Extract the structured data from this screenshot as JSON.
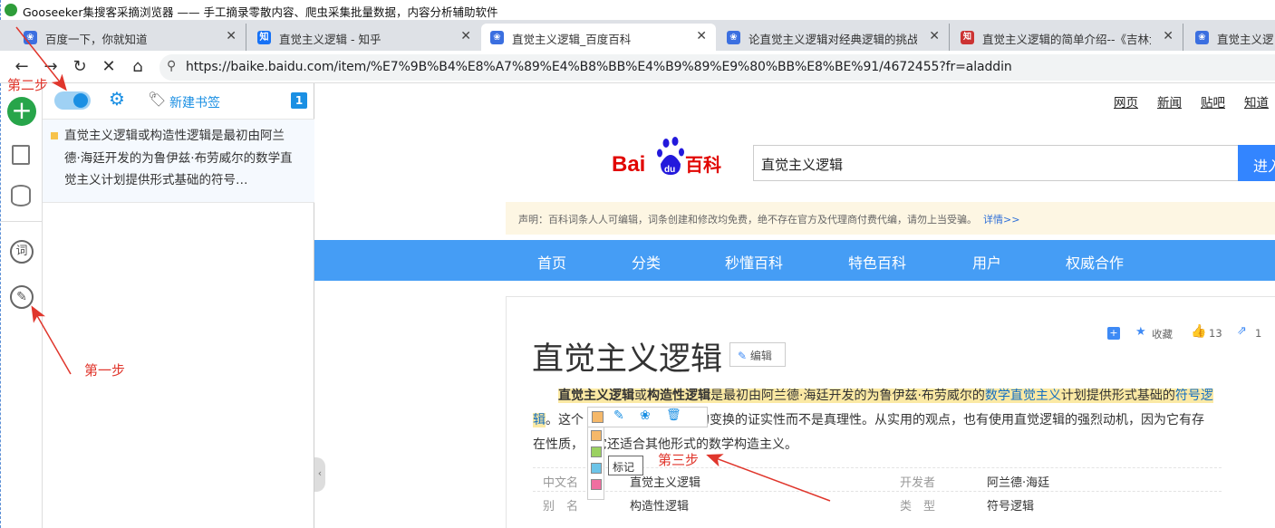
{
  "window": {
    "title": "Gooseeker集搜客采摘浏览器 —— 手工摘录零散内容、爬虫采集批量数据，内容分析辅助软件"
  },
  "tabs": [
    {
      "label": "百度一下，你就知道",
      "active": false,
      "favicon": "baidu-icon"
    },
    {
      "label": "直觉主义逻辑 - 知乎",
      "active": false,
      "favicon": "zhihu-icon"
    },
    {
      "label": "直觉主义逻辑_百度百科",
      "active": true,
      "favicon": "baidu-icon"
    },
    {
      "label": "论直觉主义逻辑对经典逻辑的挑战%C",
      "active": false,
      "favicon": "baidu-icon"
    },
    {
      "label": "直觉主义逻辑的简单介绍--《吉林大学",
      "active": false,
      "favicon": "cnki-icon"
    },
    {
      "label": "直觉主义逻",
      "active": false,
      "favicon": "baidu-icon"
    }
  ],
  "address_bar": {
    "url": "https://baike.baidu.com/item/%E7%9B%B4%E8%A7%89%E4%B8%BB%E4%B9%89%E9%80%BB%E8%BE%91/4672455?fr=aladdin"
  },
  "side_panel": {
    "new_bookmark": "新建书签",
    "count": "1",
    "note_text": "直觉主义逻辑或构造性逻辑是最初由阿兰德·海廷开发的为鲁伊兹·布劳威尔的数学直觉主义计划提供形式基础的符号…"
  },
  "annotations": {
    "step1": "第一步",
    "step2": "第二步",
    "step3": "第三步"
  },
  "baike": {
    "top_links": [
      "网页",
      "新闻",
      "贴吧",
      "知道"
    ],
    "search_value": "直觉主义逻辑",
    "search_button": "进入",
    "notice": "声明：百科词条人人可编辑，词条创建和修改均免费，绝不存在官方及代理商付费代编，请勿上当受骗。",
    "notice_link": "详情>>",
    "nav": [
      "首页",
      "分类",
      "秒懂百科",
      "特色百科",
      "用户",
      "权威合作"
    ],
    "collect": "收藏",
    "likes": "13",
    "shares": "1",
    "title": "直觉主义逻辑",
    "edit": "编辑",
    "p1_hl1": "直觉主义逻辑",
    "p1_or": "或",
    "p1_hl2": "构造性逻辑",
    "p1_a": "是最初由阿兰德·海廷开发的为鲁伊兹·布劳威尔的",
    "p1_link1": "数学直觉主义",
    "p1_b": "计划提供形式基础的",
    "p1_link2": "符号逻",
    "p2_link": "辑",
    "p2_a": "。这个",
    "p2_b": "出命题的变换的证实性而不是真理性。从实用的观点，也有使用直觉逻辑的强烈动机，因为它有存",
    "p3_a": "在性质，",
    "p3_b": "它还适合其他形式的数学构造主义。",
    "tooltip": "标记",
    "info": [
      {
        "k": "中文名",
        "v": "直觉主义逻辑"
      },
      {
        "k": "开发者",
        "v": "阿兰德·海廷"
      },
      {
        "k": "别　名",
        "v": "构造性逻辑"
      },
      {
        "k": "类　型",
        "v": "符号逻辑"
      }
    ]
  },
  "colors": {
    "accent": "#459df5",
    "baidu_red": "#e10602",
    "baidu_blue": "#2319dc",
    "arrow": "#e0362c"
  }
}
